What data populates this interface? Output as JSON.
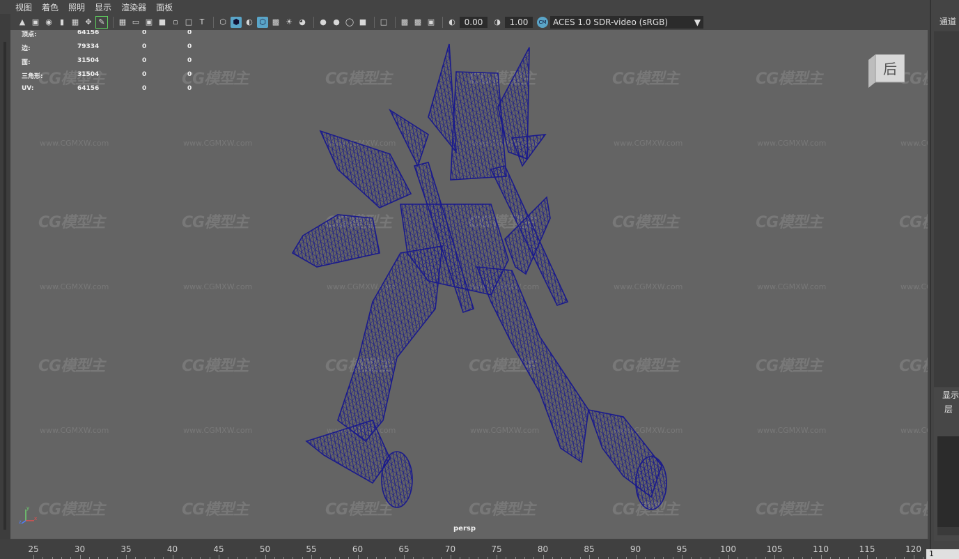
{
  "menu": {
    "items": [
      "视图",
      "着色",
      "照明",
      "显示",
      "渲染器",
      "面板"
    ]
  },
  "toolbar": {
    "exposure_value": "0.00",
    "gamma_value": "1.00",
    "color_space": "ACES 1.0 SDR-video (sRGB)"
  },
  "hud": {
    "rows": [
      {
        "label": "顶点:",
        "count": "64156",
        "sel": "0",
        "comp": "0"
      },
      {
        "label": "边:",
        "count": "79334",
        "sel": "0",
        "comp": "0"
      },
      {
        "label": "面:",
        "count": "31504",
        "sel": "0",
        "comp": "0"
      },
      {
        "label": "三角形:",
        "count": "31504",
        "sel": "0",
        "comp": "0"
      },
      {
        "label": "UV:",
        "count": "64156",
        "sel": "0",
        "comp": "0"
      }
    ]
  },
  "viewport": {
    "camera_label": "persp",
    "viewcube_label": "后",
    "wireframe_color": "#1a1a8c",
    "background_color": "#646464"
  },
  "watermark": {
    "logo_text": "CG模型主",
    "url_text": "www.CGMXW.com"
  },
  "right_panel": {
    "channel_label": "通道",
    "display_label": "显示",
    "layer_label": "层"
  },
  "timeline": {
    "ticks": [
      "25",
      "30",
      "35",
      "40",
      "45",
      "50",
      "55",
      "60",
      "65",
      "70",
      "75",
      "80",
      "85",
      "90",
      "95",
      "100",
      "105",
      "110",
      "115",
      "120"
    ],
    "current_frame": "1"
  }
}
